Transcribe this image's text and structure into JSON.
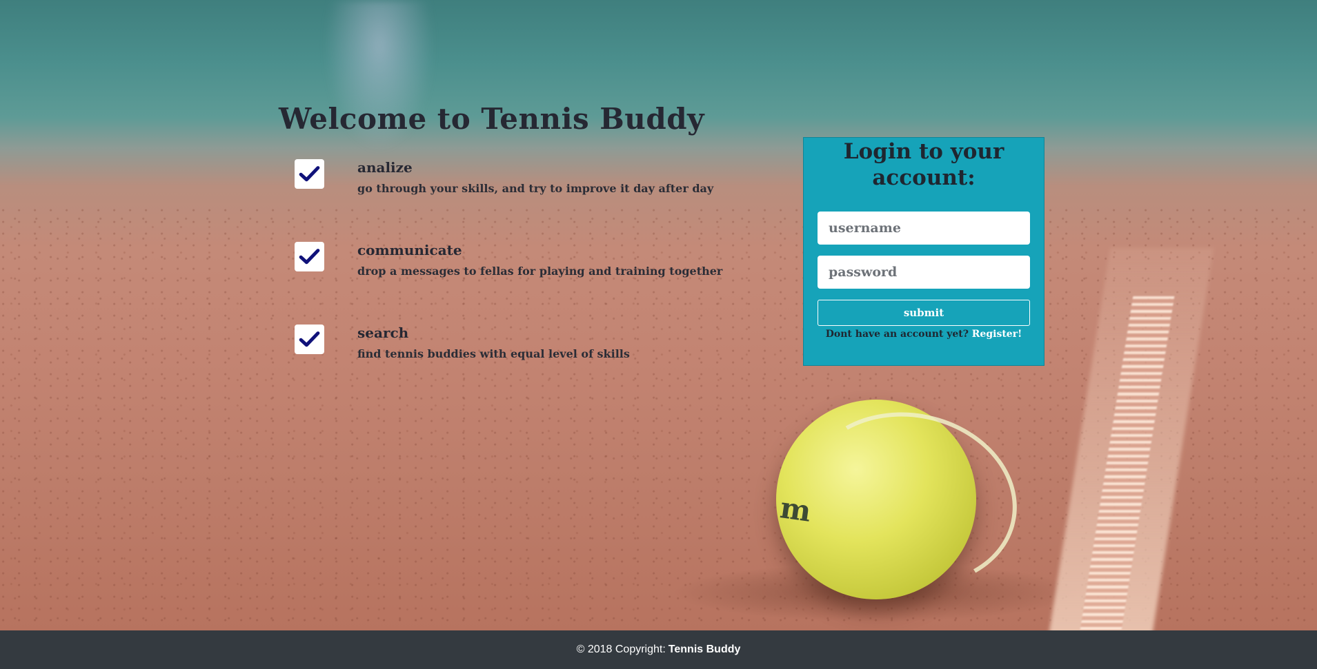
{
  "welcome": {
    "prefix": "Welcome to",
    "brand": "Tennis Buddy"
  },
  "features": [
    {
      "title": "analize",
      "description": "go through your skills, and try to improve it day after day",
      "icon": "checkmark-icon"
    },
    {
      "title": "communicate",
      "description": "drop a messages to fellas for playing and training together",
      "icon": "checkmark-icon"
    },
    {
      "title": "search",
      "description": "find tennis buddies with equal level of skills",
      "icon": "checkmark-icon"
    }
  ],
  "login": {
    "heading": "Login to your account:",
    "username_placeholder": "username",
    "password_placeholder": "password",
    "submit_label": "submit",
    "register_prompt": "Dont have an account yet?",
    "register_link": "Register!"
  },
  "footer": {
    "copyright": "© 2018 Copyright:",
    "brand": "Tennis Buddy"
  },
  "colors": {
    "login_panel": "#16a3b9",
    "footer_bg": "#343a40",
    "check_color": "#10127a",
    "heading_text": "#262833"
  }
}
